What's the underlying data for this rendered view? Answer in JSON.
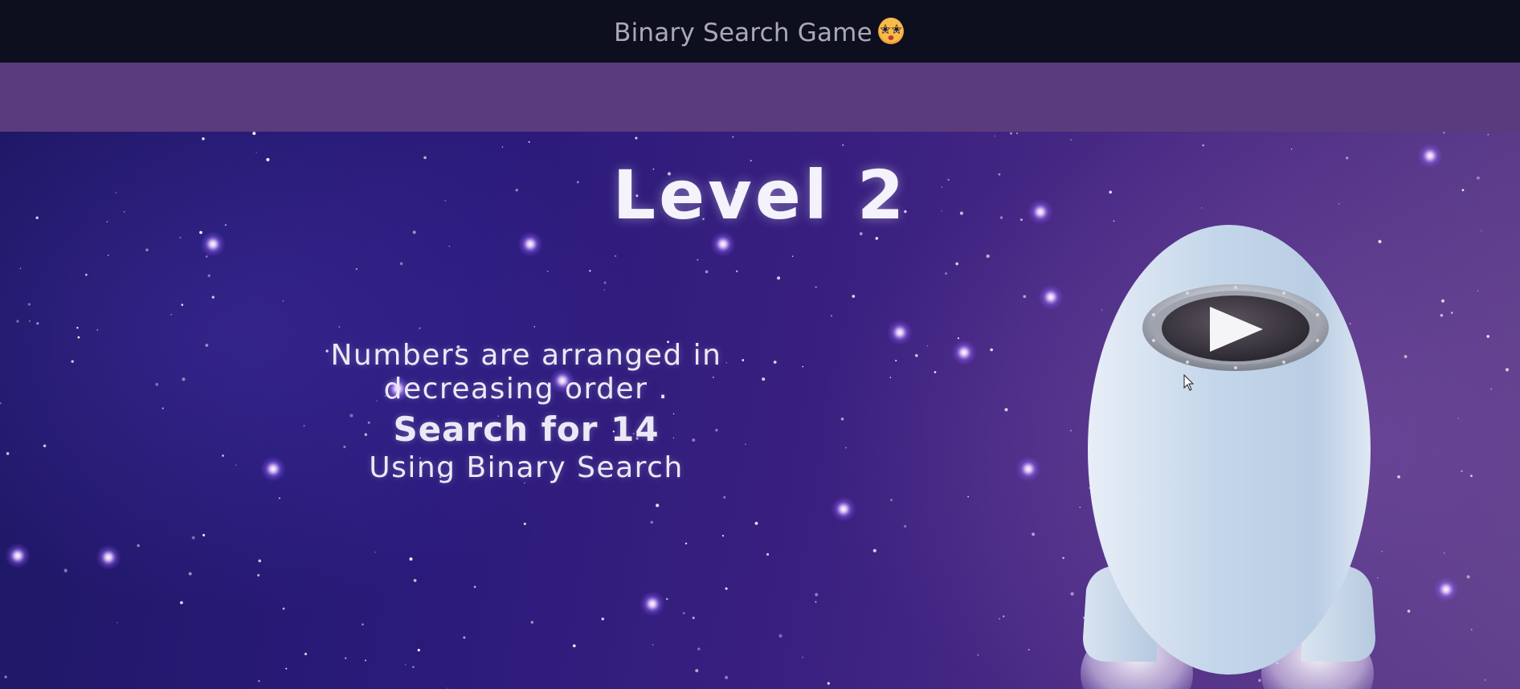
{
  "window": {
    "title": "Binary Search Game",
    "title_emoji": "star-struck-face-icon"
  },
  "level": {
    "title": "Level 2"
  },
  "instructions": {
    "line1": "Numbers are arranged in",
    "line2": "decreasing order .",
    "search_text": "Search for 14",
    "method_text": "Using Binary Search"
  },
  "rocket": {
    "play_icon": "play-icon"
  },
  "colors": {
    "titlebar_bg": "#0e0f1e",
    "band_bg": "#5a3b7d",
    "space_dark": "#1e1764",
    "space_light": "#5e3f8a",
    "rocket_body": "#c4d6ea"
  }
}
